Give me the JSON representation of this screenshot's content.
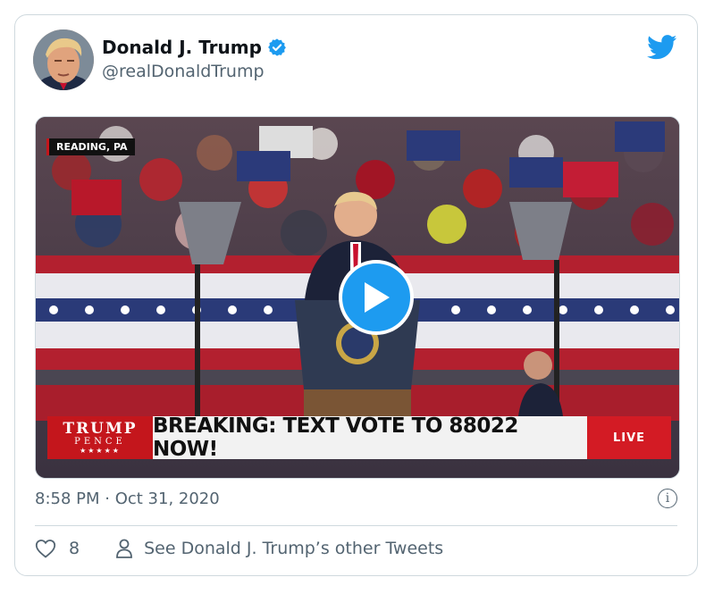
{
  "author": {
    "name": "Donald J. Trump",
    "handle": "@realDonaldTrump",
    "verified": true
  },
  "media": {
    "location_tag": "READING, PA",
    "ticker": {
      "logo_line1": "TRUMP",
      "logo_line2": "PENCE",
      "logo_line3": "★★★★★",
      "headline": "BREAKING: TEXT VOTE TO 88022 NOW!",
      "live_label": "LIVE"
    },
    "play_icon": "play-icon"
  },
  "tweet": {
    "timestamp": "8:58 PM · Oct 31, 2020",
    "info_label": "i"
  },
  "actions": {
    "like_count": "8",
    "profile_link": "See Donald J. Trump’s other Tweets"
  },
  "colors": {
    "accent": "#1d9bf0",
    "text_secondary": "#536471",
    "border": "#cfd9de",
    "ticker_red": "#c4161c"
  }
}
